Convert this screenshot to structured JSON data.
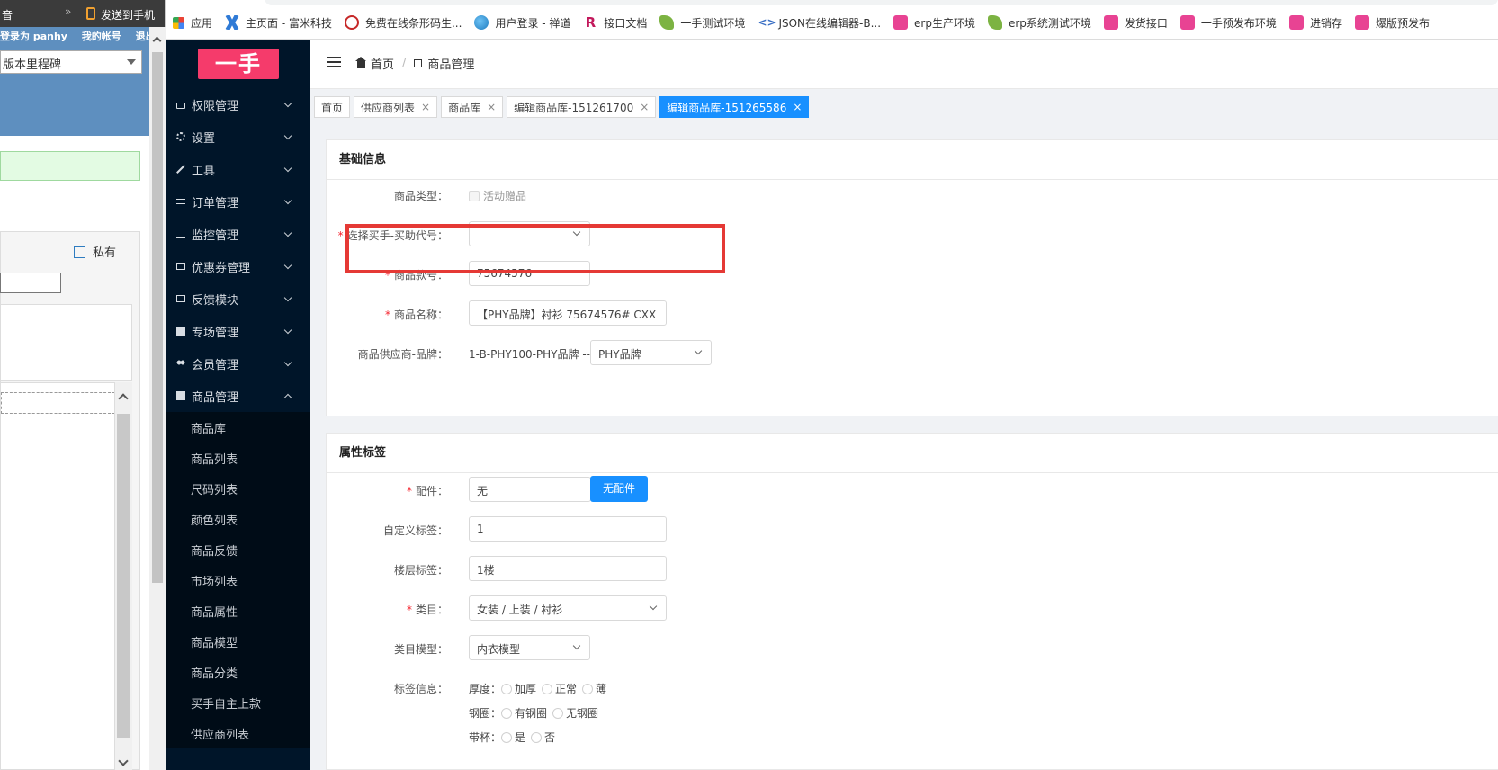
{
  "bg_window": {
    "top_text": "音",
    "top_sep": "»",
    "send_phone": "发送到手机",
    "login": "登录为 panhy",
    "my_account": "我的帐号",
    "logout": "退出",
    "select_value": "版本里程碑",
    "private_label": "私有"
  },
  "bookmarks": [
    {
      "label": "应用",
      "icon": "apps-grid-icon"
    },
    {
      "label": "主页面 - 富米科技",
      "icon": "x-logo-icon"
    },
    {
      "label": "免费在线条形码生...",
      "icon": "barcode-logo-icon"
    },
    {
      "label": "用户登录 - 禅道",
      "icon": "globe-icon"
    },
    {
      "label": "接口文档",
      "icon": "r-logo-icon"
    },
    {
      "label": "一手测试环境",
      "icon": "leaf-icon"
    },
    {
      "label": "JSON在线编辑器-B...",
      "icon": "json-icon"
    },
    {
      "label": "erp生产环境",
      "icon": "pink-logo-icon"
    },
    {
      "label": "erp系统测试环境",
      "icon": "leaf-icon"
    },
    {
      "label": "发货接口",
      "icon": "pink-logo-icon"
    },
    {
      "label": "一手预发布环境",
      "icon": "pink-logo-icon"
    },
    {
      "label": "进销存",
      "icon": "pink-logo-icon"
    },
    {
      "label": "爆版预发布",
      "icon": "pink-logo-icon"
    }
  ],
  "sidebar": {
    "logo": "一手",
    "menu": [
      {
        "label": "权限管理",
        "icon": "lock-icon"
      },
      {
        "label": "设置",
        "icon": "gear-icon"
      },
      {
        "label": "工具",
        "icon": "wrench-icon"
      },
      {
        "label": "订单管理",
        "icon": "lines-icon"
      },
      {
        "label": "监控管理",
        "icon": "pulse-icon"
      },
      {
        "label": "优惠券管理",
        "icon": "card-icon"
      },
      {
        "label": "反馈模块",
        "icon": "card-icon"
      },
      {
        "label": "专场管理",
        "icon": "table-icon"
      },
      {
        "label": "会员管理",
        "icon": "users-icon"
      },
      {
        "label": "商品管理",
        "icon": "table-icon"
      }
    ],
    "submenu": [
      "商品库",
      "商品列表",
      "尺码列表",
      "颜色列表",
      "商品反馈",
      "市场列表",
      "商品属性",
      "商品模型",
      "商品分类",
      "买手自主上款",
      "供应商列表"
    ]
  },
  "header": {
    "home": "首页",
    "current": "商品管理"
  },
  "tabs": [
    {
      "label": "首页",
      "closable": false
    },
    {
      "label": "供应商列表",
      "closable": true
    },
    {
      "label": "商品库",
      "closable": true
    },
    {
      "label": "编辑商品库-151261700",
      "closable": true
    },
    {
      "label": "编辑商品库-151265586",
      "closable": true,
      "active": true
    }
  ],
  "close_glyph": "×",
  "basic": {
    "title": "基础信息",
    "type_label": "商品类型：",
    "type_option": "活动赠品",
    "buyer_label": "选择买手-买助代号：",
    "style_label": "商品款号：",
    "style_value": "75674576",
    "name_label": "商品名称：",
    "name_value": "【PHY品牌】衬衫 75674576# CXX",
    "supplier_label": "商品供应商-品牌：",
    "supplier_code": "1-B-PHY100-PHY品牌 --",
    "brand_value": "PHY品牌"
  },
  "attrs": {
    "title": "属性标签",
    "acc_label": "配件：",
    "acc_value": "无",
    "acc_button": "无配件",
    "custom_label": "自定义标签：",
    "custom_value": "1",
    "floor_label": "楼层标签：",
    "floor_value": "1楼",
    "category_label": "类目：",
    "category_value": "女装 / 上装 / 衬衫",
    "model_label": "类目模型：",
    "model_value": "内衣模型",
    "tag_label": "标签信息：",
    "thickness_label": "厚度：",
    "thickness_opts": [
      "加厚",
      "正常",
      "薄"
    ],
    "wire_label": "钢圈：",
    "wire_opts": [
      "有钢圈",
      "无钢圈"
    ],
    "cup_label": "带杯：",
    "cup_opts": [
      "是",
      "否"
    ]
  },
  "colors": {
    "sidebar_bg": "#001529",
    "primary": "#1890ff",
    "logo_bg": "#f53b6b",
    "highlight": "#e53935",
    "required": "#f5222d"
  }
}
